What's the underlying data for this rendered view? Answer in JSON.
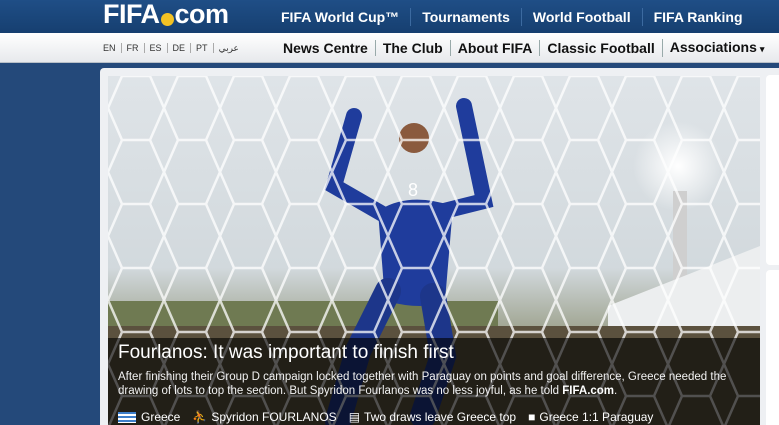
{
  "header": {
    "logo": "FIFA.com",
    "logo_parts": {
      "before": "FIFA",
      "after": "com"
    },
    "nav": [
      "FIFA World Cup™",
      "Tournaments",
      "World Football",
      "FIFA Ranking"
    ]
  },
  "subheader": {
    "languages": [
      "EN",
      "FR",
      "ES",
      "DE",
      "PT",
      "عربي"
    ],
    "nav": [
      "News Centre",
      "The Club",
      "About FIFA",
      "Classic Football",
      "Associations"
    ]
  },
  "story": {
    "headline": "Fourlanos: It was important to finish first",
    "summary_pre": "After finishing their Group D campaign locked together with Paraguay on points and goal difference, Greece needed the drawing of lots to top the section. But Spyridon Fourlanos was no less joyful, as he told ",
    "summary_link": "FIFA.com",
    "summary_post": ".",
    "player_number": "8",
    "tags": [
      {
        "icon": "greece-flag-icon",
        "label": "Greece"
      },
      {
        "icon": "player-icon",
        "label": "Spyridon FOURLANOS"
      },
      {
        "icon": "article-icon",
        "label": "Two draws leave Greece top"
      },
      {
        "icon": "video-camera-icon",
        "label": "Greece 1:1 Paraguay"
      }
    ]
  },
  "colors": {
    "header_blue": "#1c4a80",
    "background": "#24497a",
    "ball_yellow": "#f3c224"
  }
}
